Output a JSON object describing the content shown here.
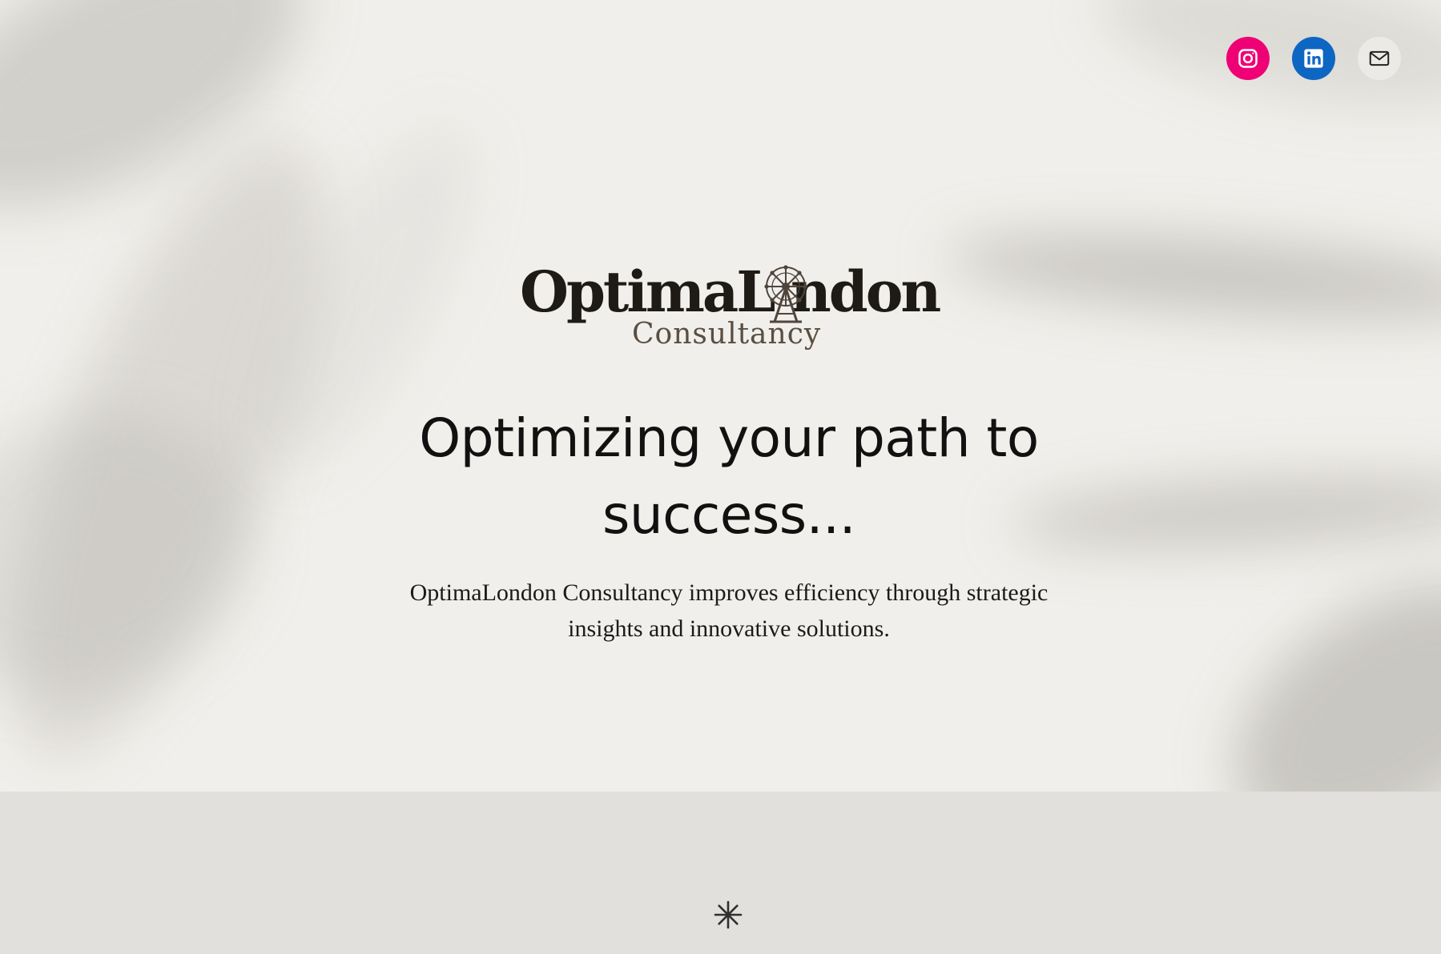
{
  "header": {
    "social_links": [
      {
        "name": "Instagram",
        "icon": "instagram-icon",
        "color": "#f00075"
      },
      {
        "name": "LinkedIn",
        "icon": "linkedin-icon",
        "color": "#0d66c2"
      },
      {
        "name": "Mail",
        "icon": "mail-icon",
        "color": "#ebeae7"
      }
    ]
  },
  "hero": {
    "logo_main": "OptimaL ndon",
    "logo_sub": "Consultancy",
    "logo_icon": "ferris-wheel-icon",
    "headline": "Optimizing your path to success...",
    "tagline": "OptimaLondon Consultancy improves efficiency through strategic insights and innovative solutions."
  },
  "section": {
    "separator_icon": "asterisk-icon"
  },
  "colors": {
    "hero_background": "#f1efeb",
    "lower_background": "#e1e0dd",
    "logo_text": "#1e1b17",
    "logo_sub_text": "#5a4e42"
  }
}
